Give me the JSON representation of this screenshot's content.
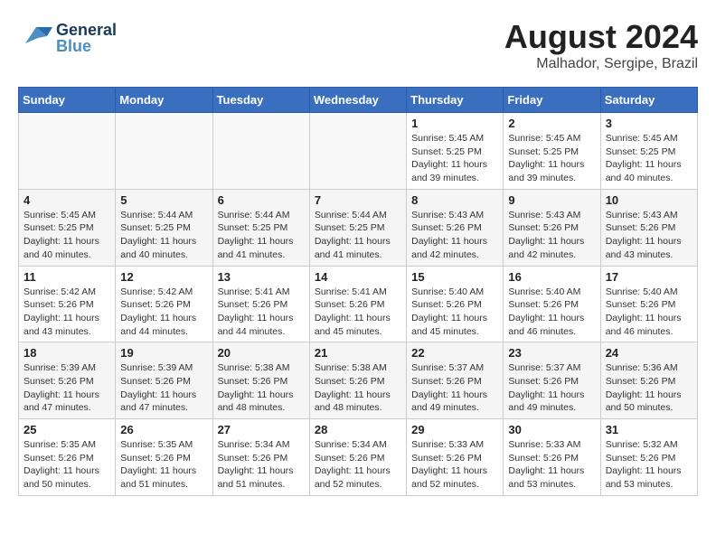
{
  "header": {
    "logo_general": "General",
    "logo_blue": "Blue",
    "month_year": "August 2024",
    "location": "Malhador, Sergipe, Brazil"
  },
  "days_of_week": [
    "Sunday",
    "Monday",
    "Tuesday",
    "Wednesday",
    "Thursday",
    "Friday",
    "Saturday"
  ],
  "weeks": [
    [
      {
        "day": "",
        "detail": ""
      },
      {
        "day": "",
        "detail": ""
      },
      {
        "day": "",
        "detail": ""
      },
      {
        "day": "",
        "detail": ""
      },
      {
        "day": "1",
        "detail": "Sunrise: 5:45 AM\nSunset: 5:25 PM\nDaylight: 11 hours\nand 39 minutes."
      },
      {
        "day": "2",
        "detail": "Sunrise: 5:45 AM\nSunset: 5:25 PM\nDaylight: 11 hours\nand 39 minutes."
      },
      {
        "day": "3",
        "detail": "Sunrise: 5:45 AM\nSunset: 5:25 PM\nDaylight: 11 hours\nand 40 minutes."
      }
    ],
    [
      {
        "day": "4",
        "detail": "Sunrise: 5:45 AM\nSunset: 5:25 PM\nDaylight: 11 hours\nand 40 minutes."
      },
      {
        "day": "5",
        "detail": "Sunrise: 5:44 AM\nSunset: 5:25 PM\nDaylight: 11 hours\nand 40 minutes."
      },
      {
        "day": "6",
        "detail": "Sunrise: 5:44 AM\nSunset: 5:25 PM\nDaylight: 11 hours\nand 41 minutes."
      },
      {
        "day": "7",
        "detail": "Sunrise: 5:44 AM\nSunset: 5:25 PM\nDaylight: 11 hours\nand 41 minutes."
      },
      {
        "day": "8",
        "detail": "Sunrise: 5:43 AM\nSunset: 5:26 PM\nDaylight: 11 hours\nand 42 minutes."
      },
      {
        "day": "9",
        "detail": "Sunrise: 5:43 AM\nSunset: 5:26 PM\nDaylight: 11 hours\nand 42 minutes."
      },
      {
        "day": "10",
        "detail": "Sunrise: 5:43 AM\nSunset: 5:26 PM\nDaylight: 11 hours\nand 43 minutes."
      }
    ],
    [
      {
        "day": "11",
        "detail": "Sunrise: 5:42 AM\nSunset: 5:26 PM\nDaylight: 11 hours\nand 43 minutes."
      },
      {
        "day": "12",
        "detail": "Sunrise: 5:42 AM\nSunset: 5:26 PM\nDaylight: 11 hours\nand 44 minutes."
      },
      {
        "day": "13",
        "detail": "Sunrise: 5:41 AM\nSunset: 5:26 PM\nDaylight: 11 hours\nand 44 minutes."
      },
      {
        "day": "14",
        "detail": "Sunrise: 5:41 AM\nSunset: 5:26 PM\nDaylight: 11 hours\nand 45 minutes."
      },
      {
        "day": "15",
        "detail": "Sunrise: 5:40 AM\nSunset: 5:26 PM\nDaylight: 11 hours\nand 45 minutes."
      },
      {
        "day": "16",
        "detail": "Sunrise: 5:40 AM\nSunset: 5:26 PM\nDaylight: 11 hours\nand 46 minutes."
      },
      {
        "day": "17",
        "detail": "Sunrise: 5:40 AM\nSunset: 5:26 PM\nDaylight: 11 hours\nand 46 minutes."
      }
    ],
    [
      {
        "day": "18",
        "detail": "Sunrise: 5:39 AM\nSunset: 5:26 PM\nDaylight: 11 hours\nand 47 minutes."
      },
      {
        "day": "19",
        "detail": "Sunrise: 5:39 AM\nSunset: 5:26 PM\nDaylight: 11 hours\nand 47 minutes."
      },
      {
        "day": "20",
        "detail": "Sunrise: 5:38 AM\nSunset: 5:26 PM\nDaylight: 11 hours\nand 48 minutes."
      },
      {
        "day": "21",
        "detail": "Sunrise: 5:38 AM\nSunset: 5:26 PM\nDaylight: 11 hours\nand 48 minutes."
      },
      {
        "day": "22",
        "detail": "Sunrise: 5:37 AM\nSunset: 5:26 PM\nDaylight: 11 hours\nand 49 minutes."
      },
      {
        "day": "23",
        "detail": "Sunrise: 5:37 AM\nSunset: 5:26 PM\nDaylight: 11 hours\nand 49 minutes."
      },
      {
        "day": "24",
        "detail": "Sunrise: 5:36 AM\nSunset: 5:26 PM\nDaylight: 11 hours\nand 50 minutes."
      }
    ],
    [
      {
        "day": "25",
        "detail": "Sunrise: 5:35 AM\nSunset: 5:26 PM\nDaylight: 11 hours\nand 50 minutes."
      },
      {
        "day": "26",
        "detail": "Sunrise: 5:35 AM\nSunset: 5:26 PM\nDaylight: 11 hours\nand 51 minutes."
      },
      {
        "day": "27",
        "detail": "Sunrise: 5:34 AM\nSunset: 5:26 PM\nDaylight: 11 hours\nand 51 minutes."
      },
      {
        "day": "28",
        "detail": "Sunrise: 5:34 AM\nSunset: 5:26 PM\nDaylight: 11 hours\nand 52 minutes."
      },
      {
        "day": "29",
        "detail": "Sunrise: 5:33 AM\nSunset: 5:26 PM\nDaylight: 11 hours\nand 52 minutes."
      },
      {
        "day": "30",
        "detail": "Sunrise: 5:33 AM\nSunset: 5:26 PM\nDaylight: 11 hours\nand 53 minutes."
      },
      {
        "day": "31",
        "detail": "Sunrise: 5:32 AM\nSunset: 5:26 PM\nDaylight: 11 hours\nand 53 minutes."
      }
    ]
  ]
}
